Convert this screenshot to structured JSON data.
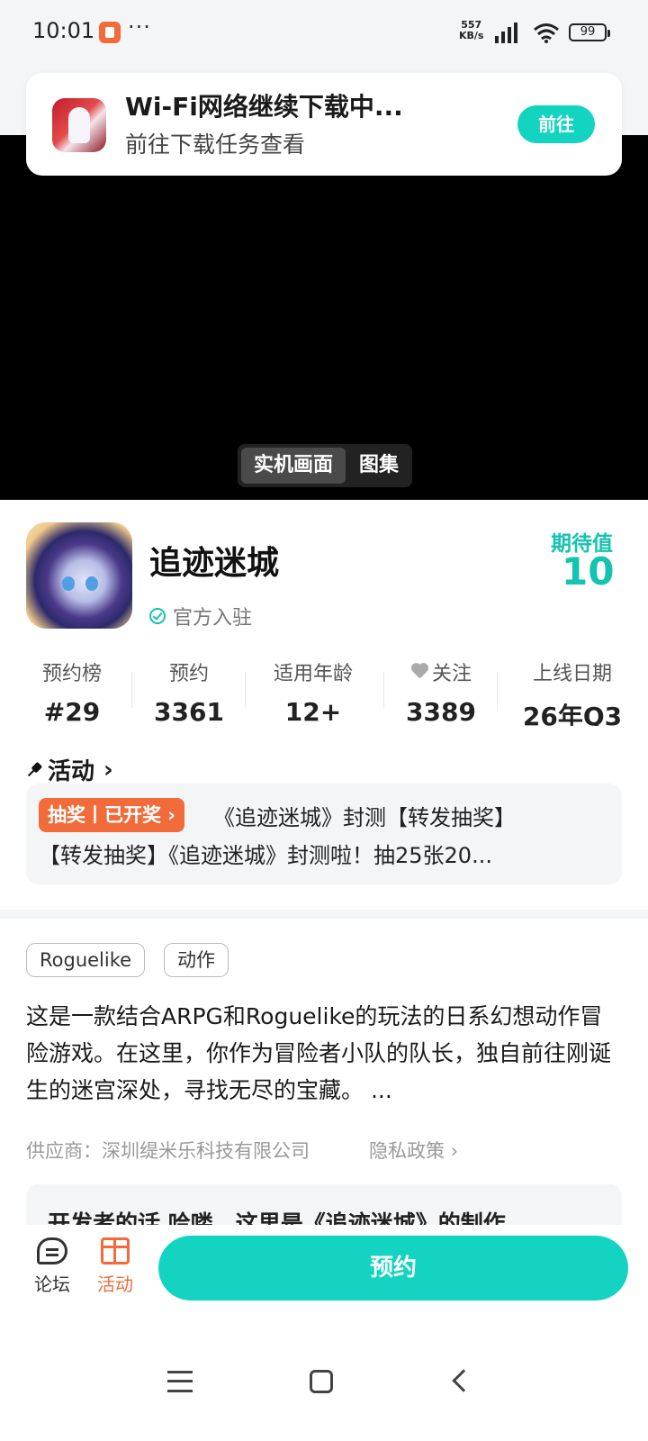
{
  "status_bar": {
    "time": "10:01",
    "dots": "···",
    "speed_value": "557",
    "speed_unit": "KB/s",
    "battery": "99"
  },
  "toast": {
    "title": "Wi-Fi网络继续下载中...",
    "subtitle": "前往下载任务查看",
    "button": "前往"
  },
  "media_switch": {
    "active": "实机画面",
    "other": "图集"
  },
  "game": {
    "title": "追迹迷城",
    "official": "官方入驻",
    "expect_label": "期待值",
    "expect_value": "10"
  },
  "stats": [
    {
      "label": "预约榜",
      "value": "#29"
    },
    {
      "label": "预约",
      "value": "3361"
    },
    {
      "label": "适用年龄",
      "value": "12+"
    },
    {
      "label": "关注",
      "value": "3389"
    },
    {
      "label": "上线日期",
      "value": "26年Q3"
    }
  ],
  "activity": {
    "header": "活动",
    "badge": "抽奖丨已开奖",
    "line1": "《追迹迷城》封测【转发抽奖】",
    "line2": "【转发抽奖】《追迹迷城》封测啦！抽25张20..."
  },
  "tags": [
    "Roguelike",
    "动作"
  ],
  "description": "这是一款结合ARPG和Roguelike的玩法的日系幻想动作冒险游戏。在这里，你作为冒险者小队的队长，独自前往刚诞生的迷宫深处，寻找无尽的宝藏。 ...",
  "vendor": "供应商：深圳缇米乐科技有限公司",
  "privacy": "隐私政策",
  "dev_note": "开发者的话  哈喽，这里是《追迹迷城》的制作",
  "bottom_bar": {
    "forum": "论坛",
    "activity": "活动",
    "reserve": "预约"
  },
  "colors": {
    "accent": "#13d4c0",
    "orange": "#f26b3a"
  }
}
